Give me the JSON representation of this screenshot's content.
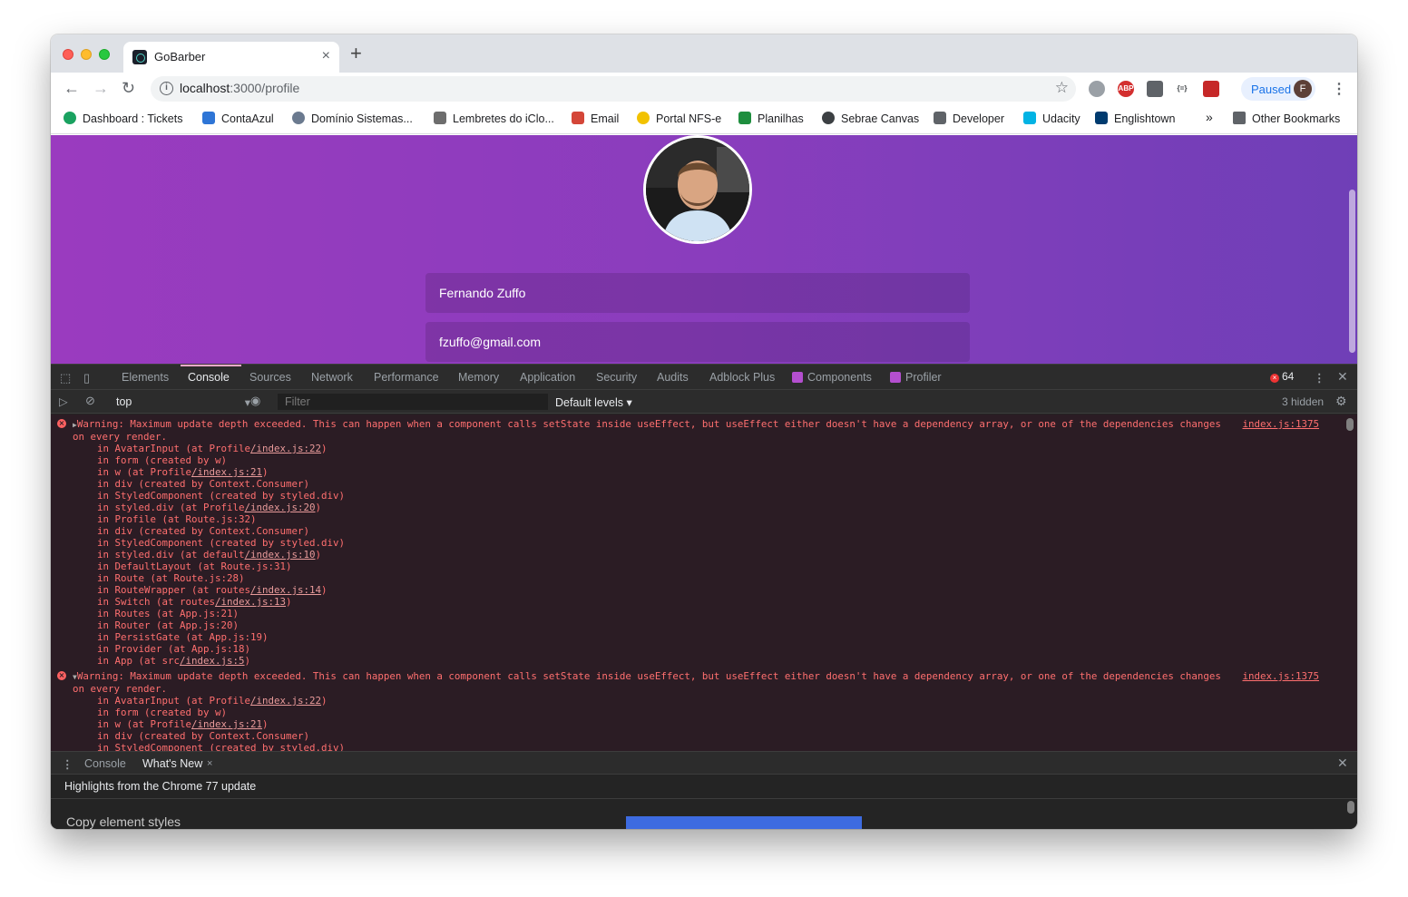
{
  "browser": {
    "tab_title": "GoBarber",
    "url_host": "localhost",
    "url_path": ":3000/profile",
    "paused_label": "Paused",
    "profile_initial": "F",
    "extensions": [
      {
        "name": "grey-balloon-icon",
        "label": "",
        "color": "#9aa0a6"
      },
      {
        "name": "abp-icon",
        "label": "ABP",
        "color": "#d32f2f"
      },
      {
        "name": "shield-ext-icon",
        "label": "",
        "color": "#5f6368"
      },
      {
        "name": "json-ext-icon",
        "label": "{=}",
        "color": "#ffffff"
      },
      {
        "name": "red-ext-icon",
        "label": "",
        "color": "#c62828"
      }
    ]
  },
  "bookmarks": {
    "items": [
      {
        "label": "Dashboard : Tickets",
        "icon": "dashboard-icon",
        "color": "#1aa260"
      },
      {
        "label": "ContaAzul",
        "icon": "contaazul-icon",
        "color": "#2e75d6"
      },
      {
        "label": "Domínio Sistemas...",
        "icon": "gear-icon",
        "color": "#6b7a8f"
      },
      {
        "label": "Lembretes do iClo...",
        "icon": "apple-icon",
        "color": "#6d6d6d"
      },
      {
        "label": "Email",
        "icon": "gmail-icon",
        "color": "#d44638"
      },
      {
        "label": "Portal NFS-e",
        "icon": "nfse-icon",
        "color": "#f2c200"
      },
      {
        "label": "Planilhas",
        "icon": "sheets-icon",
        "color": "#1e8e3e"
      },
      {
        "label": "Sebrae Canvas",
        "icon": "globe-icon",
        "color": "#3c4043"
      },
      {
        "label": "Developer",
        "icon": "folder-icon",
        "color": "#5f6368"
      },
      {
        "label": "Udacity",
        "icon": "udacity-icon",
        "color": "#02b3e4"
      },
      {
        "label": "Englishtown",
        "icon": "ef-icon",
        "color": "#003b6f"
      }
    ],
    "overflow": "»",
    "other": "Other Bookmarks"
  },
  "page": {
    "name_value": "Fernando Zuffo",
    "email_value": "fzuffo@gmail.com"
  },
  "devtools": {
    "tabs": [
      "Elements",
      "Console",
      "Sources",
      "Network",
      "Performance",
      "Memory",
      "Application",
      "Security",
      "Audits",
      "Adblock Plus",
      "Components",
      "Profiler"
    ],
    "error_count": "64",
    "context": "top",
    "filter_placeholder": "Filter",
    "levels": "Default levels ▾",
    "hidden": "3 hidden",
    "messages": [
      {
        "toggle": "▶",
        "text": "Warning: Maximum update depth exceeded. This can happen when a component calls setState inside useEffect, but useEffect either doesn't have a dependency array, or one of the dependencies changes on every render.",
        "source": "index.js:1375",
        "stack": [
          [
            "in AvatarInput (at Profile",
            "/index.js:22",
            ")"
          ],
          [
            "in form (created by w)",
            "",
            ""
          ],
          [
            "in w (at Profile",
            "/index.js:21",
            ")"
          ],
          [
            "in div (created by Context.Consumer)",
            "",
            ""
          ],
          [
            "in StyledComponent (created by styled.div)",
            "",
            ""
          ],
          [
            "in styled.div (at Profile",
            "/index.js:20",
            ")"
          ],
          [
            "in Profile (at Route.js:32)",
            "",
            ""
          ],
          [
            "in div (created by Context.Consumer)",
            "",
            ""
          ],
          [
            "in StyledComponent (created by styled.div)",
            "",
            ""
          ],
          [
            "in styled.div (at default",
            "/index.js:10",
            ")"
          ],
          [
            "in DefaultLayout (at Route.js:31)",
            "",
            ""
          ],
          [
            "in Route (at Route.js:28)",
            "",
            ""
          ],
          [
            "in RouteWrapper (at routes",
            "/index.js:14",
            ")"
          ],
          [
            "in Switch (at routes",
            "/index.js:13",
            ")"
          ],
          [
            "in Routes (at App.js:21)",
            "",
            ""
          ],
          [
            "in Router (at App.js:20)",
            "",
            ""
          ],
          [
            "in PersistGate (at App.js:19)",
            "",
            ""
          ],
          [
            "in Provider (at App.js:18)",
            "",
            ""
          ],
          [
            "in App (at src",
            "/index.js:5",
            ")"
          ]
        ]
      },
      {
        "toggle": "▼",
        "text": "Warning: Maximum update depth exceeded. This can happen when a component calls setState inside useEffect, but useEffect either doesn't have a dependency array, or one of the dependencies changes on every render.",
        "source": "index.js:1375",
        "stack": [
          [
            "in AvatarInput (at Profile",
            "/index.js:22",
            ")"
          ],
          [
            "in form (created by w)",
            "",
            ""
          ],
          [
            "in w (at Profile",
            "/index.js:21",
            ")"
          ],
          [
            "in div (created by Context.Consumer)",
            "",
            ""
          ],
          [
            "in StyledComponent (created by styled.div)",
            "",
            ""
          ]
        ]
      }
    ],
    "drawer": {
      "tabs": [
        "Console",
        "What's New"
      ],
      "highlights": "Highlights from the Chrome 77 update",
      "first_item": "Copy element styles"
    }
  }
}
